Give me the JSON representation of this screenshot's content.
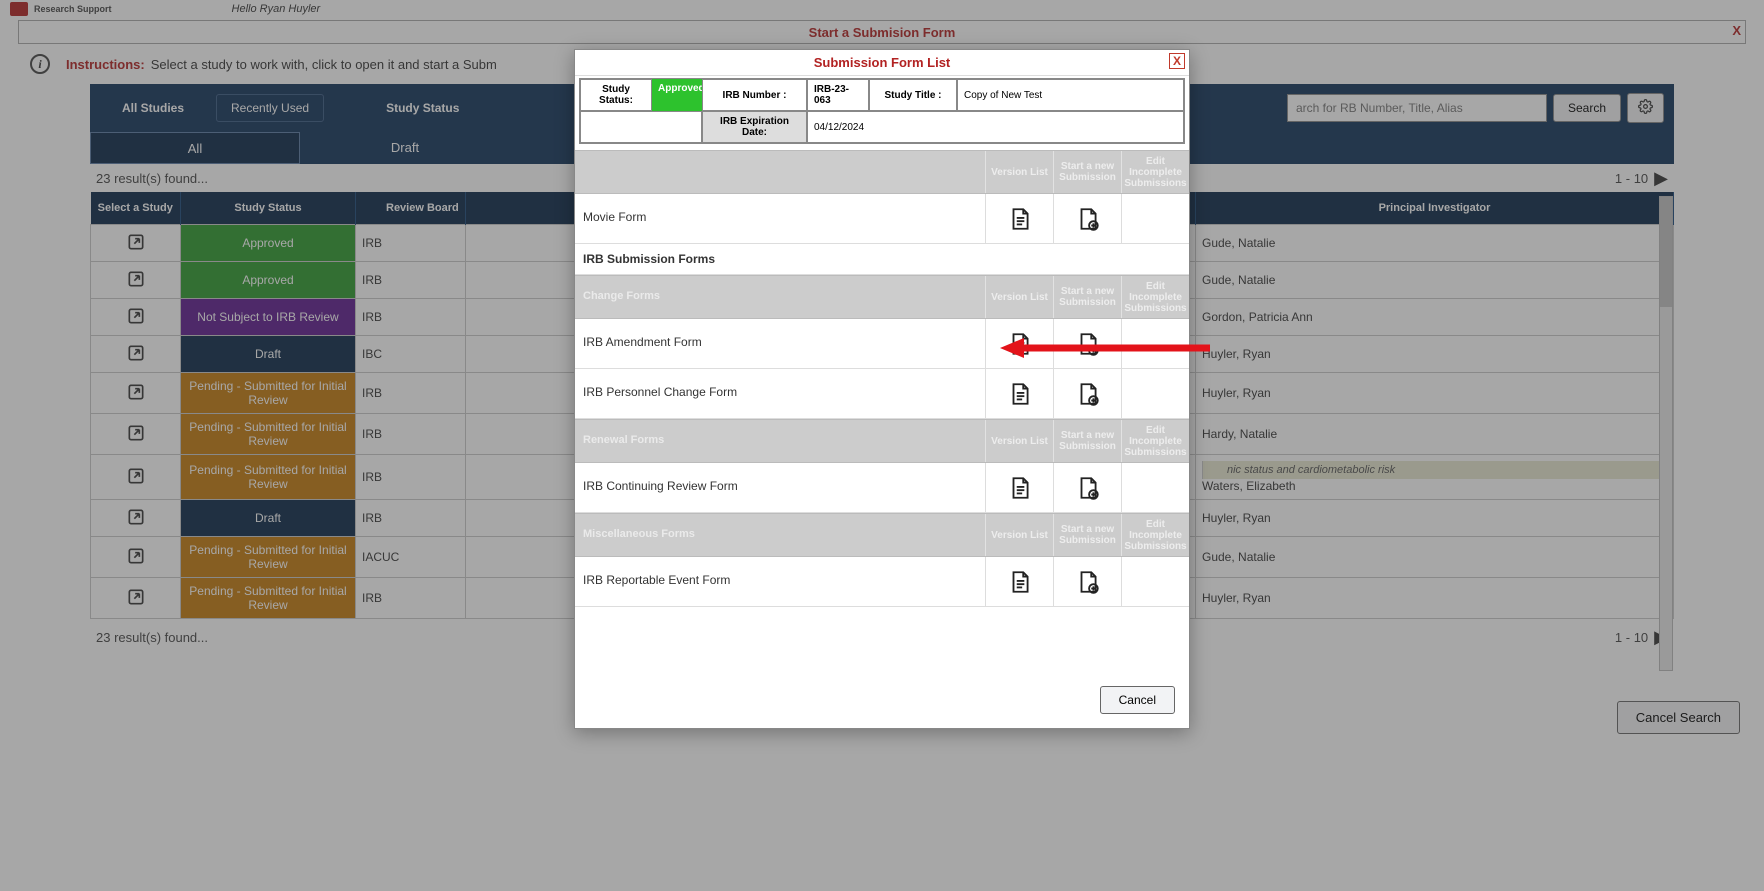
{
  "brand": {
    "name": "Research Support",
    "hello": "Hello Ryan Huyler"
  },
  "subheader": {
    "title": "Start a Submision Form",
    "close": "X"
  },
  "instructions": {
    "label": "Instructions:",
    "text": "Select a study to work with, click to open it and start a Subm"
  },
  "tabs": {
    "all_studies": "All Studies",
    "recently": "Recently Used",
    "status": "Study Status"
  },
  "search": {
    "placeholder": "arch for RB Number, Title, Alias",
    "button": "Search"
  },
  "sub_tabs": {
    "all": "All",
    "draft": "Draft"
  },
  "results": {
    "found": "23 result(s) found...",
    "range": "1 - 10"
  },
  "grid_headers": {
    "select": "Select a Study",
    "status": "Study Status",
    "board": "Review Board",
    "pi": "Principal Investigator"
  },
  "rows": [
    {
      "status": "Approved",
      "status_class": "status-approved",
      "board": "IRB",
      "pi": "Gude, Natalie"
    },
    {
      "status": "Approved",
      "status_class": "status-approved",
      "board": "IRB",
      "pi": "Gude, Natalie"
    },
    {
      "status": "Not Subject to IRB Review",
      "status_class": "status-notsubj",
      "board": "IRB",
      "pi": "Gordon, Patricia Ann"
    },
    {
      "status": "Draft",
      "status_class": "status-draft",
      "board": "IBC",
      "pi": "Huyler, Ryan"
    },
    {
      "status": "Pending - Submitted for Initial Review",
      "status_class": "status-pending",
      "board": "IRB",
      "pi": "Huyler, Ryan"
    },
    {
      "status": "Pending - Submitted for Initial Review",
      "status_class": "status-pending",
      "board": "IRB",
      "pi": "Hardy, Natalie"
    },
    {
      "status": "Pending - Submitted for Initial Review",
      "status_class": "status-pending",
      "board": "IRB",
      "pi": "Waters, Elizabeth",
      "alt": "nic status and cardiometabolic risk"
    },
    {
      "status": "Draft",
      "status_class": "status-draft",
      "board": "IRB",
      "pi": "Huyler, Ryan"
    },
    {
      "status": "Pending - Submitted for Initial Review",
      "status_class": "status-pending",
      "board": "IACUC",
      "pi": "Gude, Natalie"
    },
    {
      "status": "Pending - Submitted for Initial Review",
      "status_class": "status-pending",
      "board": "IRB",
      "pi": "Huyler, Ryan"
    }
  ],
  "cancel_search": "Cancel Search",
  "modal": {
    "title": "Submission Form List",
    "close": "X",
    "meta": {
      "study_status_label": "Study Status:",
      "study_status_value": "Approved",
      "irb_number_label": "IRB Number :",
      "irb_number_value": "IRB-23-063",
      "study_title_label": "Study Title :",
      "study_title_value": "Copy of New Test",
      "irb_exp_label": "IRB Expiration Date:",
      "irb_exp_value": "04/12/2024"
    },
    "columns": {
      "version": "Version List",
      "start": "Start a new Submission",
      "edit": "Edit Incomplete Submissions"
    },
    "group_irb_label": "IRB Submission Forms",
    "section_blank": "",
    "section_change": "Change Forms",
    "section_renewal": "Renewal Forms",
    "section_misc": "Miscellaneous Forms",
    "forms": {
      "movie": "Movie Form",
      "amend": "IRB Amendment Form",
      "personnel": "IRB Personnel Change Form",
      "continuing": "IRB Continuing Review Form",
      "reportable": "IRB Reportable Event Form"
    },
    "cancel": "Cancel"
  }
}
